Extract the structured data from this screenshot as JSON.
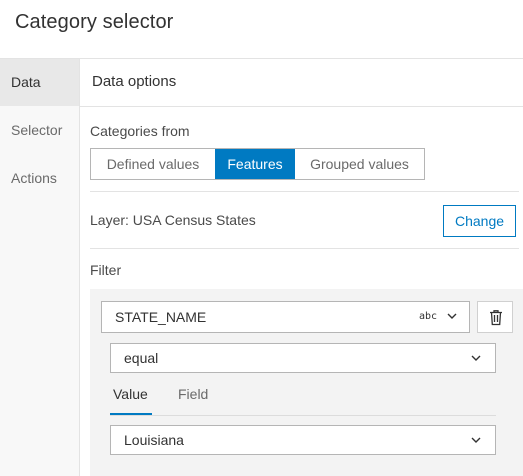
{
  "header": {
    "title": "Category selector"
  },
  "sidebar": {
    "items": [
      {
        "label": "Data"
      },
      {
        "label": "Selector"
      },
      {
        "label": "Actions"
      }
    ]
  },
  "main": {
    "section_title": "Data options",
    "categories_from_label": "Categories from",
    "segmented": [
      {
        "label": "Defined values"
      },
      {
        "label": "Features"
      },
      {
        "label": "Grouped values"
      }
    ],
    "layer_label": "Layer: USA Census States",
    "change_label": "Change",
    "filter_label": "Filter",
    "filter": {
      "field_name": "STATE_NAME",
      "field_type_label": "abc",
      "operator": "equal",
      "tabs": [
        {
          "label": "Value"
        },
        {
          "label": "Field"
        }
      ],
      "value": "Louisiana"
    }
  },
  "colors": {
    "accent": "#007ac2",
    "sidebar_active": "#e8e8e8"
  },
  "icons": {
    "chevron": "chevron-down-icon",
    "trash": "trash-icon"
  }
}
